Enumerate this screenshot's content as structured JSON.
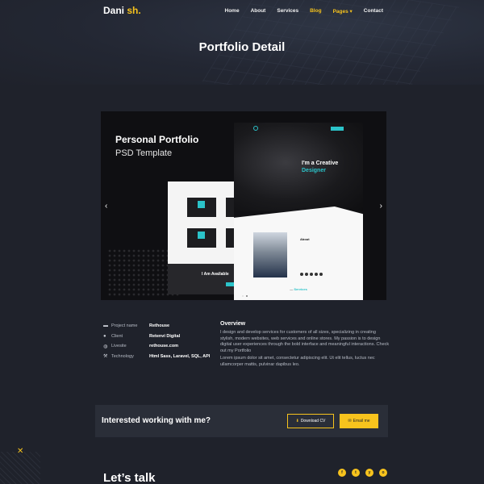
{
  "header": {
    "logo_main": "Dani",
    "logo_accent": "sh.",
    "nav": [
      {
        "label": "Home"
      },
      {
        "label": "About"
      },
      {
        "label": "Services"
      },
      {
        "label": "Blog"
      },
      {
        "label": "Pages ▾"
      },
      {
        "label": "Contact"
      }
    ]
  },
  "page_title": "Portfolio Detail",
  "slider": {
    "title": "Personal Portfolio",
    "subtitle": "PSD Template",
    "prev_arrow": "‹",
    "next_arrow": "›",
    "mock": {
      "creative_line1": "I'm a Creative",
      "creative_line2": "Designer",
      "about": "About",
      "available": "I Am Available",
      "services_prefix": "—",
      "services": "Services"
    }
  },
  "project": {
    "rows": [
      {
        "label": "Project name",
        "value": "Rethouse",
        "icon": "folder-icon"
      },
      {
        "label": "Client",
        "value": "Retenvi Digital",
        "icon": "user-icon"
      },
      {
        "label": "Livesite",
        "value": "rethouse.com",
        "icon": "globe-icon"
      },
      {
        "label": "Technology",
        "value": "Html Sass, Laravel, SQL, API",
        "icon": "wrench-icon"
      }
    ],
    "overview_title": "Overview",
    "overview_p1": "I design and develop services for customers of all sizes, specializing in creating stylish, modern websites, web services and online stores. My passion is to design digital user experiences through the bold interface and meaningful interactions. Check out my Portfolio",
    "overview_p2": "Lorem ipsum dolor sit amet, consectetur adipiscing elit. Ut elit tellus, luctus nec ullamcorper mattis, pulvinar dapibus leo."
  },
  "cta": {
    "text": "Interested working with me?",
    "download_label": "Download CV",
    "email_label": "Email me"
  },
  "footer": {
    "talk": "Let’s talk",
    "socials": [
      "f",
      "t",
      "y",
      "o"
    ]
  },
  "colors": {
    "accent": "#f7c31d",
    "background": "#1f222b",
    "mock_accent": "#2bc3c9"
  }
}
